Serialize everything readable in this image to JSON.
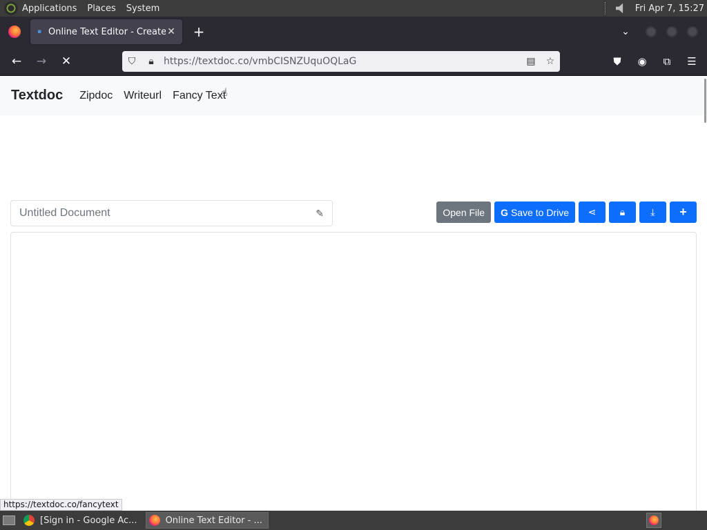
{
  "top_panel": {
    "menus": [
      "Applications",
      "Places",
      "System"
    ],
    "clock": "Fri Apr  7, 15:27"
  },
  "browser": {
    "tab_title": "Online Text Editor - Create, E",
    "url_host": "https://textdoc.co",
    "url_path": "/vmbCISNZUquOQLaG"
  },
  "site": {
    "brand": "Textdoc",
    "nav": [
      "Zipdoc",
      "Writeurl",
      "Fancy Text"
    ],
    "doc_title_placeholder": "Untitled Document",
    "buttons": {
      "open_file": "Open File",
      "save_drive": "Save to Drive"
    },
    "status_link": "https://textdoc.co/fancytext"
  },
  "taskbar": {
    "tasks": [
      "[Sign in - Google Ac...",
      "Online Text Editor - ..."
    ]
  },
  "colors": {
    "primary": "#0d6efd",
    "secondary": "#6c757d",
    "browser_chrome": "#2b2a33"
  }
}
